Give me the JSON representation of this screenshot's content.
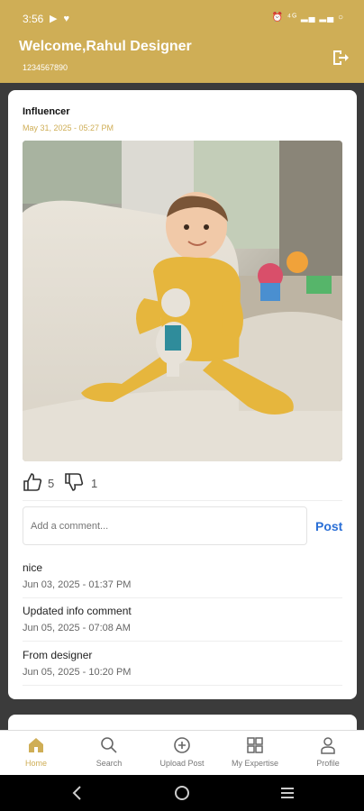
{
  "status_bar": {
    "time": "3:56",
    "left_icons": "▶ ♥",
    "right_icons": "⏰ ⁴ᴳ ▂▄ ▂▄ ○"
  },
  "header": {
    "welcome": "Welcome,Rahul Designer",
    "phone": "1234567890"
  },
  "post": {
    "title": "Influencer",
    "date": "May 31, 2025 - 05:27 PM",
    "likes": "5",
    "dislikes": "1",
    "comment_placeholder": "Add a comment...",
    "post_label": "Post",
    "comments": [
      {
        "text": "nice",
        "date": "Jun 03, 2025 - 01:37 PM"
      },
      {
        "text": "Updated info comment",
        "date": "Jun 05, 2025 - 07:08 AM"
      },
      {
        "text": "From designer",
        "date": "Jun 05, 2025 - 10:20 PM"
      }
    ]
  },
  "nav": {
    "items": [
      {
        "label": "Home",
        "icon": "home-icon",
        "active": true
      },
      {
        "label": "Search",
        "icon": "search-icon"
      },
      {
        "label": "Upload Post",
        "icon": "upload-icon"
      },
      {
        "label": "My Expertise",
        "icon": "grid-icon"
      },
      {
        "label": "Profile",
        "icon": "profile-icon"
      }
    ]
  },
  "colors": {
    "brand": "#cfae56",
    "link": "#2a6fd6"
  }
}
